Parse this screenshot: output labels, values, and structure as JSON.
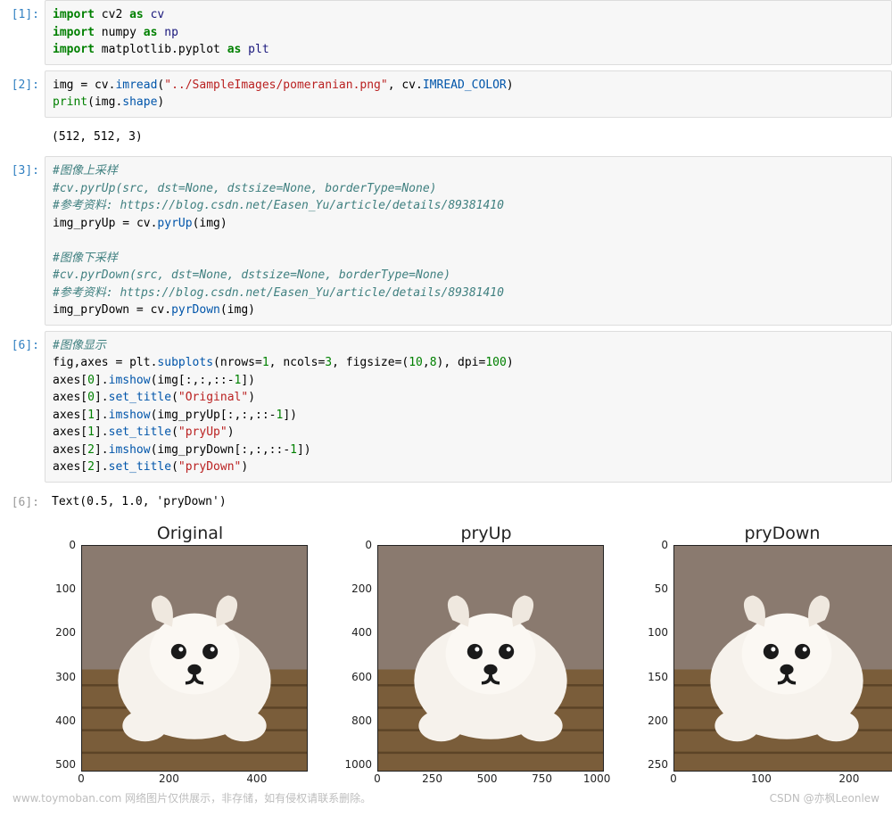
{
  "cells": {
    "c1": {
      "prompt": "[1]:"
    },
    "c2": {
      "prompt": "[2]:",
      "out_shape": "(512, 512, 3)"
    },
    "c3": {
      "prompt": "[3]:"
    },
    "c6a": {
      "prompt": "[6]:"
    },
    "c6b": {
      "prompt": "[6]:",
      "out_text": "Text(0.5, 1.0, 'pryDown')"
    }
  },
  "code1": {
    "l1_kw1": "import",
    "l1_mod": " cv2 ",
    "l1_kw2": "as",
    "l1_alias": " cv",
    "l2_kw1": "import",
    "l2_mod": " numpy ",
    "l2_kw2": "as",
    "l2_alias": " np",
    "l3_kw1": "import",
    "l3_mod": " matplotlib.pyplot ",
    "l3_kw2": "as",
    "l3_alias": " plt"
  },
  "code2": {
    "l1_a": "img ",
    "l1_eq": "= ",
    "l1_b": "cv",
    "l1_dot1": ".",
    "l1_fn": "imread",
    "l1_p1": "(",
    "l1_str": "\"../SampleImages/pomeranian.png\"",
    "l1_c": ", cv",
    "l1_dot2": ".",
    "l1_const": "IMREAD_COLOR",
    "l1_p2": ")",
    "l2_fn": "print",
    "l2_p1": "(img",
    "l2_dot": ".",
    "l2_attr": "shape",
    "l2_p2": ")"
  },
  "code3": {
    "c1": "#图像上采样",
    "c2": "#cv.pyrUp(src, dst=None, dstsize=None, borderType=None)",
    "c3": "#参考资料: https://blog.csdn.net/Easen_Yu/article/details/89381410",
    "l1_a": "img_pryUp ",
    "l1_eq": "= ",
    "l1_b": "cv",
    "l1_dot": ".",
    "l1_fn": "pyrUp",
    "l1_args": "(img)",
    "blank": "",
    "c4": "#图像下采样",
    "c5": "#cv.pyrDown(src, dst=None, dstsize=None, borderType=None)",
    "c6": "#参考资料: https://blog.csdn.net/Easen_Yu/article/details/89381410",
    "l2_a": "img_pryDown ",
    "l2_eq": "= ",
    "l2_b": "cv",
    "l2_dot": ".",
    "l2_fn": "pyrDown",
    "l2_args": "(img)"
  },
  "code6": {
    "c1": "#图像显示",
    "l1_a": "fig,axes ",
    "l1_eq": "= ",
    "l1_b": "plt",
    "l1_dot": ".",
    "l1_fn": "subplots",
    "l1_p1": "(nrows",
    "l1_eq2": "=",
    "l1_n1": "1",
    "l1_c1": ", ncols",
    "l1_eq3": "=",
    "l1_n2": "3",
    "l1_c2": ", figsize",
    "l1_eq4": "=",
    "l1_p2": "(",
    "l1_n3": "10",
    "l1_c3": ",",
    "l1_n4": "8",
    "l1_p3": ")",
    "l1_c4": ", dpi",
    "l1_eq5": "=",
    "l1_n5": "100",
    "l1_p4": ")",
    "l2_a": "axes[",
    "l2_n": "0",
    "l2_b": "]",
    "l2_dot": ".",
    "l2_fn": "imshow",
    "l2_args_a": "(img[:,:,::",
    "l2_neg": "-",
    "l2_one": "1",
    "l2_args_b": "])",
    "l3_a": "axes[",
    "l3_n": "0",
    "l3_b": "]",
    "l3_dot": ".",
    "l3_fn": "set_title",
    "l3_p1": "(",
    "l3_str": "\"Original\"",
    "l3_p2": ")",
    "l4_a": "axes[",
    "l4_n": "1",
    "l4_b": "]",
    "l4_dot": ".",
    "l4_fn": "imshow",
    "l4_args_a": "(img_pryUp[:,:,::",
    "l4_neg": "-",
    "l4_one": "1",
    "l4_args_b": "])",
    "l5_a": "axes[",
    "l5_n": "1",
    "l5_b": "]",
    "l5_dot": ".",
    "l5_fn": "set_title",
    "l5_p1": "(",
    "l5_str": "\"pryUp\"",
    "l5_p2": ")",
    "l6_a": "axes[",
    "l6_n": "2",
    "l6_b": "]",
    "l6_dot": ".",
    "l6_fn": "imshow",
    "l6_args_a": "(img_pryDown[:,:,::",
    "l6_neg": "-",
    "l6_one": "1",
    "l6_args_b": "])",
    "l7_a": "axes[",
    "l7_n": "2",
    "l7_b": "]",
    "l7_dot": ".",
    "l7_fn": "set_title",
    "l7_p1": "(",
    "l7_str": "\"pryDown\"",
    "l7_p2": ")"
  },
  "watermarks": {
    "left": "www.toymoban.com   网络图片仅供展示，非存储，如有侵权请联系删除。",
    "right": "CSDN @亦枫Leonlew"
  },
  "chart_data": [
    {
      "type": "image",
      "title": "Original",
      "xlim": [
        0,
        512
      ],
      "ylim": [
        512,
        0
      ],
      "xticks": [
        0,
        200,
        400
      ],
      "yticks": [
        0,
        100,
        200,
        300,
        400,
        500
      ],
      "content": "pomeranian photo 512x512"
    },
    {
      "type": "image",
      "title": "pryUp",
      "xlim": [
        0,
        1024
      ],
      "ylim": [
        1024,
        0
      ],
      "xticks": [
        0,
        250,
        500,
        750,
        1000
      ],
      "yticks": [
        0,
        200,
        400,
        600,
        800,
        1000
      ],
      "content": "pomeranian photo upsampled 1024x1024"
    },
    {
      "type": "image",
      "title": "pryDown",
      "xlim": [
        0,
        256
      ],
      "ylim": [
        256,
        0
      ],
      "xticks": [
        0,
        100,
        200
      ],
      "yticks": [
        0,
        50,
        100,
        150,
        200,
        250
      ],
      "content": "pomeranian photo downsampled 256x256"
    }
  ]
}
